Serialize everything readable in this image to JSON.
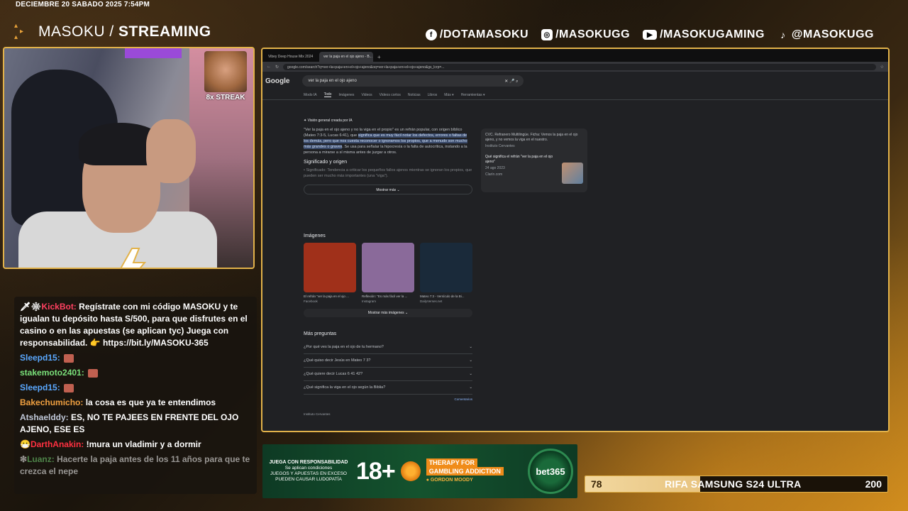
{
  "overlay": {
    "datetime": "DECIEMBRE 20 SABADO 2025 7:54PM",
    "brand_part1": "MASOKU /",
    "brand_part2": " STREAMING",
    "socials": [
      {
        "icon": "facebook-icon",
        "label": "/DOTAMASOKU"
      },
      {
        "icon": "instagram-icon",
        "label": "/MASOKUGG"
      },
      {
        "icon": "youtube-icon",
        "label": "/MASOKUGAMING"
      },
      {
        "icon": "tiktok-icon",
        "label": "@MASOKUGG"
      }
    ],
    "streak_label": "8x STREAK",
    "accent_color": "#e2b24a"
  },
  "chat": {
    "messages": [
      {
        "user": "KickBot:",
        "user_color": "#ff4060",
        "text": "Regístrate con mi código MASOKU y te igualan tu depósito hasta S/500, para que disfrutes en el casino o en las apuestas (se aplican tyc) Juega con responsabilidad. 👉 https://bit.ly/MASOKU-365",
        "prefix": "🗡❇",
        "dim": false
      },
      {
        "user": "Sleepd15:",
        "user_color": "#5aa8ff",
        "text": "",
        "prefix": "",
        "dim": false
      },
      {
        "user": "stakemoto2401:",
        "user_color": "#7ae07a",
        "text": "",
        "prefix": "",
        "dim": false
      },
      {
        "user": "Sleepd15:",
        "user_color": "#5aa8ff",
        "text": "",
        "prefix": "",
        "dim": false
      },
      {
        "user": "Bakechumicho:",
        "user_color": "#f0a040",
        "text": "la cosa es que ya te entendimos",
        "prefix": "",
        "dim": false
      },
      {
        "user": "Atshaelddy:",
        "user_color": "#c0c8d8",
        "text": "ES, NO TE PAJEES EN FRENTE DEL OJO AJENO, ESE ES",
        "prefix": "",
        "dim": false
      },
      {
        "user": "DarthAnakin:",
        "user_color": "#ff3040",
        "text": "!mura un vladimir y a dormir",
        "prefix": "😷",
        "dim": false
      },
      {
        "user": "Luanz:",
        "user_color": "#7ae07a",
        "text": "Hacerte la paja antes de los 11 años para que te crezca el nepe",
        "prefix": "❇",
        "dim": true
      }
    ]
  },
  "browser": {
    "tabs": [
      "Vibey Deep House Mix 2024",
      "ver la paja en el ojo ajeno - B..."
    ],
    "new_tab": "+",
    "url": "google.com/search?q=ver+la+paja+en+el+ojo+ajeno&oq=ver+la+paja+en+el+ojo+ajeno&gs_lcrp=...",
    "logo": "Google",
    "query": "ver la paja en el ojo ajeno",
    "search_tabs": [
      "Modo IA",
      "Todo",
      "Imágenes",
      "Videos",
      "Videos cortos",
      "Noticias",
      "Libros",
      "Más ▾",
      "Herramientas ▾"
    ],
    "active_tab": "Todo",
    "ai_title": "Visión general creada por IA",
    "ai_text_1": "\"Ver la paja en el ojo ajeno y no la viga en el propio\" es un refrán popular, con origen bíblico (Mateo 7:3-5, Lucas 6:41), que ",
    "ai_text_hl": "significa que es muy fácil notar los defectos, errores o faltas de los demás, pero que nos cuesta reconocer o ignoramos los propios, que a menudo son mucho más grandes o graves",
    "ai_text_2": ". Se usa para señalar la hipocresía o la falta de autocrítica, instando a la persona a mirarse a sí misma antes de juzgar a otros.",
    "section_title": "Significado y origen",
    "bullet": "• Significado: Tendencia a criticar los pequeños fallos ajenos mientras se ignoran los propios, que pueden ser mucho más importantes (una \"viga\").",
    "more_btn": "Mostrar más ⌄",
    "side_card_text": "CVC. Refranero Multilingüe. Ficha: Vemos la paja en el ojo ajeno, y no vemos la viga en el nuestro.",
    "side_card_src": "Instituto Cervantes",
    "side_card_q": "Qué significa el refrán \"ver la paja en el ojo ajeno\"",
    "side_card_date": "24 ago 2023",
    "side_card_src2": "Clarín.com",
    "images_title": "Imágenes",
    "images": [
      {
        "caption": "El refrán \"ver la paja en el ojo ...",
        "source": "Facebook",
        "color": "#a0301a"
      },
      {
        "caption": "Reflexión: \"Es más fácil ver la ...",
        "source": "Instagram",
        "color": "#8a6a9a"
      },
      {
        "caption": "Mateo 7:3 - Versículo de la Bi...",
        "source": "DailyVerses.net",
        "color": "#1a2a3a"
      }
    ],
    "more_images": "Mostrar más imágenes ⌄",
    "paa_title": "Más preguntas",
    "paa": [
      "¿Por qué ves la paja en el ojo de tu hermano?",
      "¿Qué quiso decir Jesús en Mateo 7 3?",
      "¿Qué quiere decir Lucas 6 41 42?",
      "¿Qué significa la viga en el ojo según la Biblia?"
    ],
    "comments": "Comentarios",
    "next_source": "Instituto Cervantes"
  },
  "ad": {
    "line1": "JUEGA CON RESPONSABILIDAD",
    "line2": "Se aplican condiciones",
    "line3": "JUEGOS Y APUESTAS EN EXCESO",
    "line4": "PUEDEN CAUSAR LUDOPATÍA",
    "age": "18+",
    "therapy1": "THERAPY FOR",
    "therapy2": "GAMBLING ADDICTION",
    "therapy3": "● GORDON MOODY",
    "brand": "bet365"
  },
  "raffle": {
    "min": "78",
    "label": "RIFA SAMSUNG S24 ULTRA",
    "max": "200",
    "progress": 0.38
  }
}
